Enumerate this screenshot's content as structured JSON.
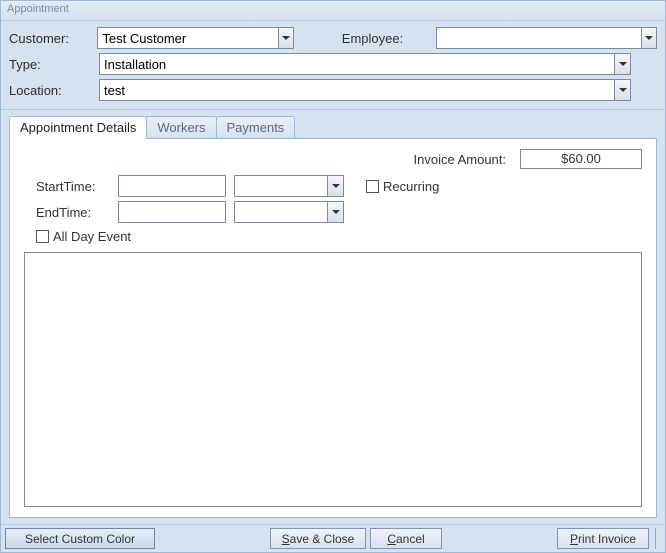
{
  "window": {
    "title": "Appointment"
  },
  "header": {
    "customer_label": "Customer:",
    "customer_value": "Test Customer",
    "employee_label": "Employee:",
    "employee_value": "",
    "type_label": "Type:",
    "type_value": "Installation",
    "location_label": "Location:",
    "location_value": "test"
  },
  "tabs": {
    "details": "Appointment Details",
    "workers": "Workers",
    "payments": "Payments"
  },
  "details": {
    "invoice_label": "Invoice Amount:",
    "invoice_value": "$60.00",
    "start_label": "StartTime:",
    "end_label": "EndTime:",
    "recurring_label": "Recurring",
    "allday_label": "All Day Event"
  },
  "footer": {
    "color": "Select Custom Color",
    "save": "ave & Close",
    "save_hot": "S",
    "cancel": "ancel",
    "cancel_hot": "C",
    "print": "rint Invoice",
    "print_hot": "P"
  }
}
